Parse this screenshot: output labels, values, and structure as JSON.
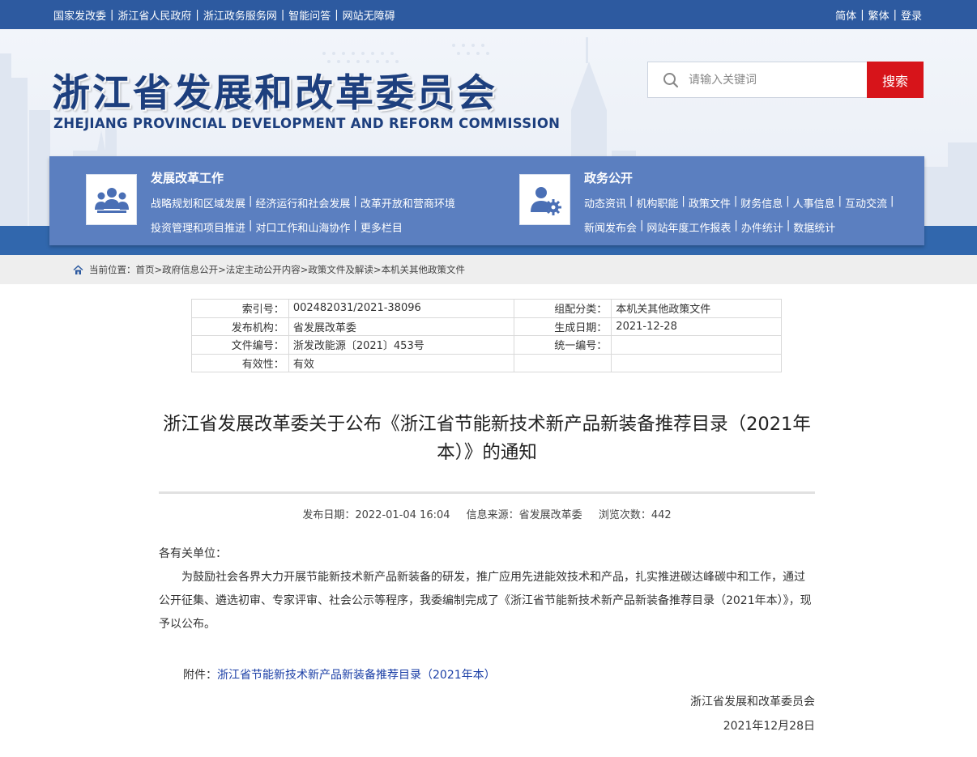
{
  "topbar": {
    "left_links": [
      "国家发改委",
      "浙江省人民政府",
      "浙江政务服务网",
      "智能问答",
      "网站无障碍"
    ],
    "right_links": [
      "简体",
      "繁体",
      "登录"
    ]
  },
  "header": {
    "logo_cn": "浙江省发展和改革委员会",
    "logo_en": "ZHEJIANG PROVINCIAL DEVELOPMENT AND REFORM COMMISSION",
    "search_placeholder": "请输入关键词",
    "search_button": "搜索"
  },
  "nav": {
    "group1": {
      "title": "发展改革工作",
      "line1": [
        "战略规划和区域发展",
        "经济运行和社会发展",
        "改革开放和营商环境"
      ],
      "line2": [
        "投资管理和项目推进",
        "对口工作和山海协作",
        "更多栏目"
      ]
    },
    "group2": {
      "title": "政务公开",
      "line1": [
        "动态资讯",
        "机构职能",
        "政策文件",
        "财务信息",
        "人事信息",
        "互动交流"
      ],
      "line2": [
        "新闻发布会",
        "网站年度工作报表",
        "办件统计",
        "数据统计"
      ]
    }
  },
  "breadcrumb": {
    "prefix": "当前位置：",
    "items": [
      "首页",
      "政府信息公开",
      "法定主动公开内容",
      "政策文件及解读",
      "本机关其他政策文件"
    ]
  },
  "meta": {
    "rows": [
      {
        "k1": "索引号：",
        "v1": "002482031/2021-38096",
        "k2": "组配分类：",
        "v2": "本机关其他政策文件"
      },
      {
        "k1": "发布机构：",
        "v1": "省发展改革委",
        "k2": "生成日期：",
        "v2": "2021-12-28"
      },
      {
        "k1": "文件编号：",
        "v1": "浙发改能源〔2021〕453号",
        "k2": "统一编号：",
        "v2": ""
      },
      {
        "k1": "有效性：",
        "v1": "有效",
        "k2": "",
        "v2": ""
      }
    ]
  },
  "article": {
    "title": "浙江省发展改革委关于公布《浙江省节能新技术新产品新装备推荐目录（2021年本）》的通知",
    "publish_date": "发布日期：2022-01-04 16:04",
    "source": "信息来源：省发展改革委",
    "views": "浏览次数：442",
    "salutation": "各有关单位：",
    "paragraph": "为鼓励社会各界大力开展节能新技术新产品新装备的研发，推广应用先进能效技术和产品，扎实推进碳达峰碳中和工作，通过公开征集、遴选初审、专家评审、社会公示等程序，我委编制完成了《浙江省节能新技术新产品新装备推荐目录（2021年本）》，现予以公布。",
    "attachment_label": "附件：",
    "attachment_link": "浙江省节能新技术新产品新装备推荐目录（2021年本）",
    "signature": "浙江省发展和改革委员会",
    "sign_date": "2021年12月28日"
  },
  "colors": {
    "topbar": "#2d5aa0",
    "nav_panel": "#5b7fc0",
    "search_button": "#d7141a",
    "link": "#1a3ea6"
  },
  "icons": [
    "search-icon",
    "group-people-icon",
    "user-gear-icon",
    "home-icon"
  ]
}
